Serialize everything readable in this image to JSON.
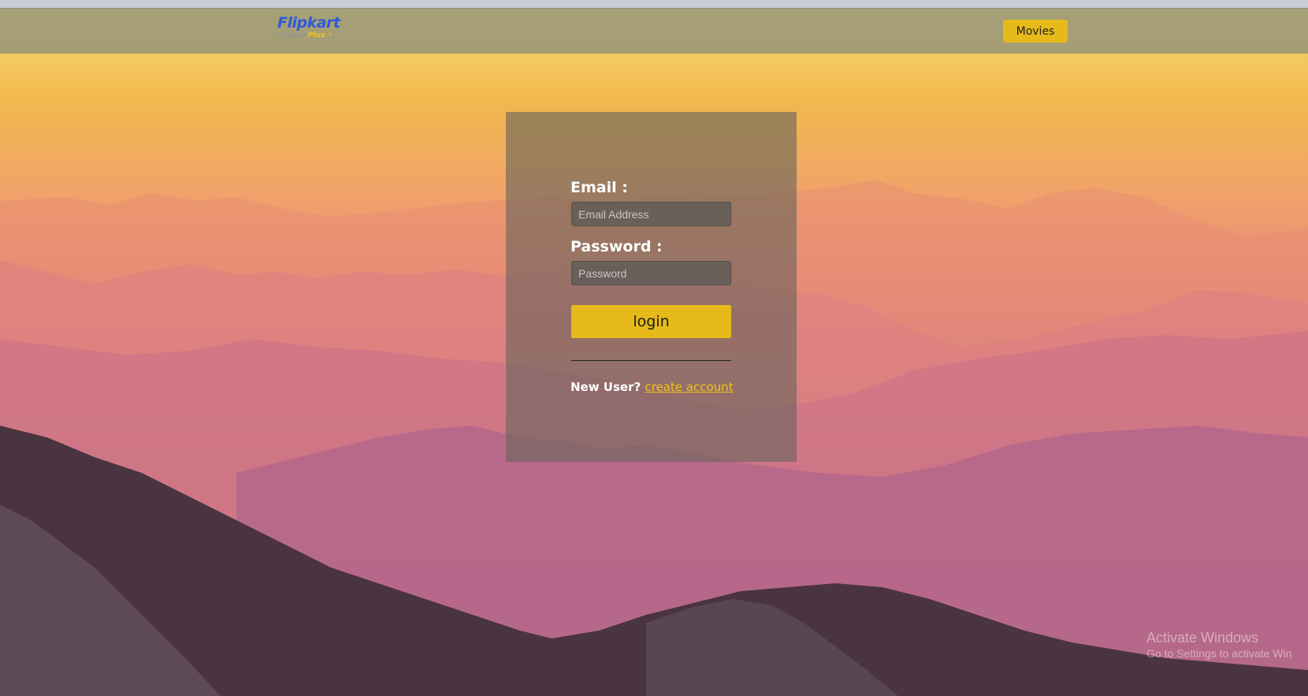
{
  "navbar": {
    "logo": {
      "name": "Flipkart",
      "tagline_explore": "Explore",
      "tagline_plus": "Plus"
    },
    "movies_button": "Movies"
  },
  "login_form": {
    "email_label": "Email :",
    "email_placeholder": "Email Address",
    "password_label": "Password :",
    "password_placeholder": "Password",
    "login_button": "login",
    "new_user_text": "New User?",
    "create_account_link": "create account"
  },
  "watermark": {
    "line1": "Activate Windows",
    "line2": "Go to Settings to activate Win"
  },
  "colors": {
    "accent": "#e6ba1a",
    "logo_blue": "#2f5ad8",
    "link": "#f0c419"
  }
}
